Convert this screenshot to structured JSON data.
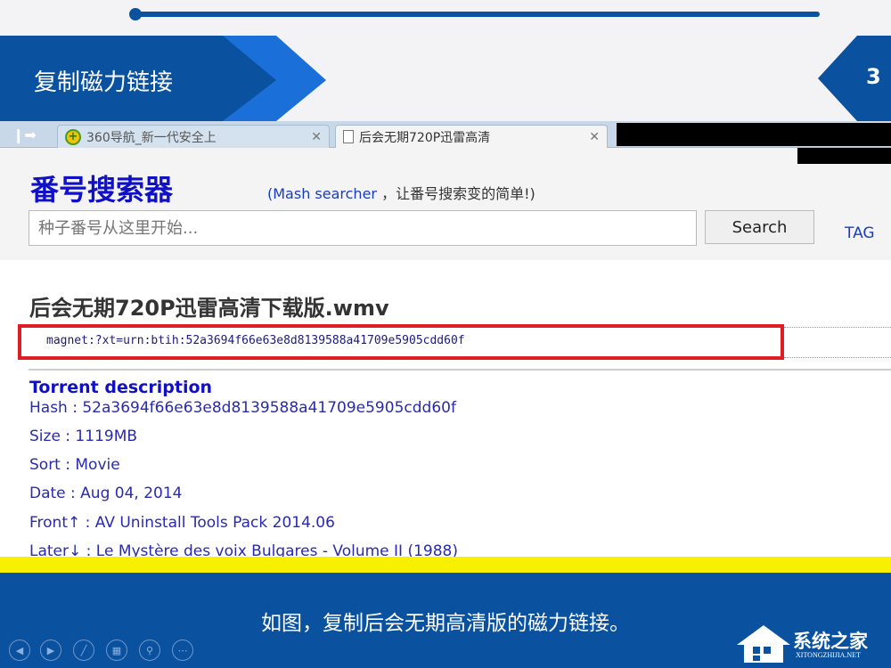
{
  "slide": {
    "title": "复制磁力链接",
    "page_number": "3",
    "caption": "如图，复制后会无期高清版的磁力链接。",
    "colors": {
      "primary_blue": "#0a52a0",
      "accent_blue": "#1a6fd8",
      "highlight_yellow": "#f7f000",
      "highlight_red": "#e01c24"
    }
  },
  "browser": {
    "tabs": [
      {
        "title": "360导航_新一代安全上",
        "icon": "360-logo-icon",
        "active": false
      },
      {
        "title": "后会无期720P迅雷高清",
        "icon": "document-icon",
        "active": true
      }
    ],
    "close_glyph": "✕"
  },
  "site": {
    "logo": "番号搜索器",
    "subtitle_en": "(Mash searcher",
    "subtitle_cn": "，让番号搜索变的简单!)",
    "search_placeholder": "种子番号从这里开始...",
    "search_button": "Search",
    "tag_link": "TAG"
  },
  "torrent": {
    "file_title": "后会无期720P迅雷高清下载版.wmv",
    "magnet": "magnet:?xt=urn:btih:52a3694f66e63e8d8139588a41709e5905cdd60f",
    "description_heading": "Torrent description",
    "rows": [
      "Hash : 52a3694f66e63e8d8139588a41709e5905cdd60f",
      "Size : 1119MB",
      "Sort : Movie",
      "Date : Aug 04, 2014",
      "Front↑ : AV Uninstall Tools Pack 2014.06",
      "Later↓ : Le Mystère des voix Bulgares - Volume II (1988)"
    ]
  },
  "controls": [
    {
      "name": "previous",
      "glyph": "◀"
    },
    {
      "name": "next",
      "glyph": "▶"
    },
    {
      "name": "pen",
      "glyph": "╱"
    },
    {
      "name": "slides",
      "glyph": "▦"
    },
    {
      "name": "zoom",
      "glyph": "⚲"
    },
    {
      "name": "more",
      "glyph": "⋯"
    }
  ],
  "watermark": {
    "cn": "系统之家",
    "en": "XITONGZHIJIA.NET"
  }
}
